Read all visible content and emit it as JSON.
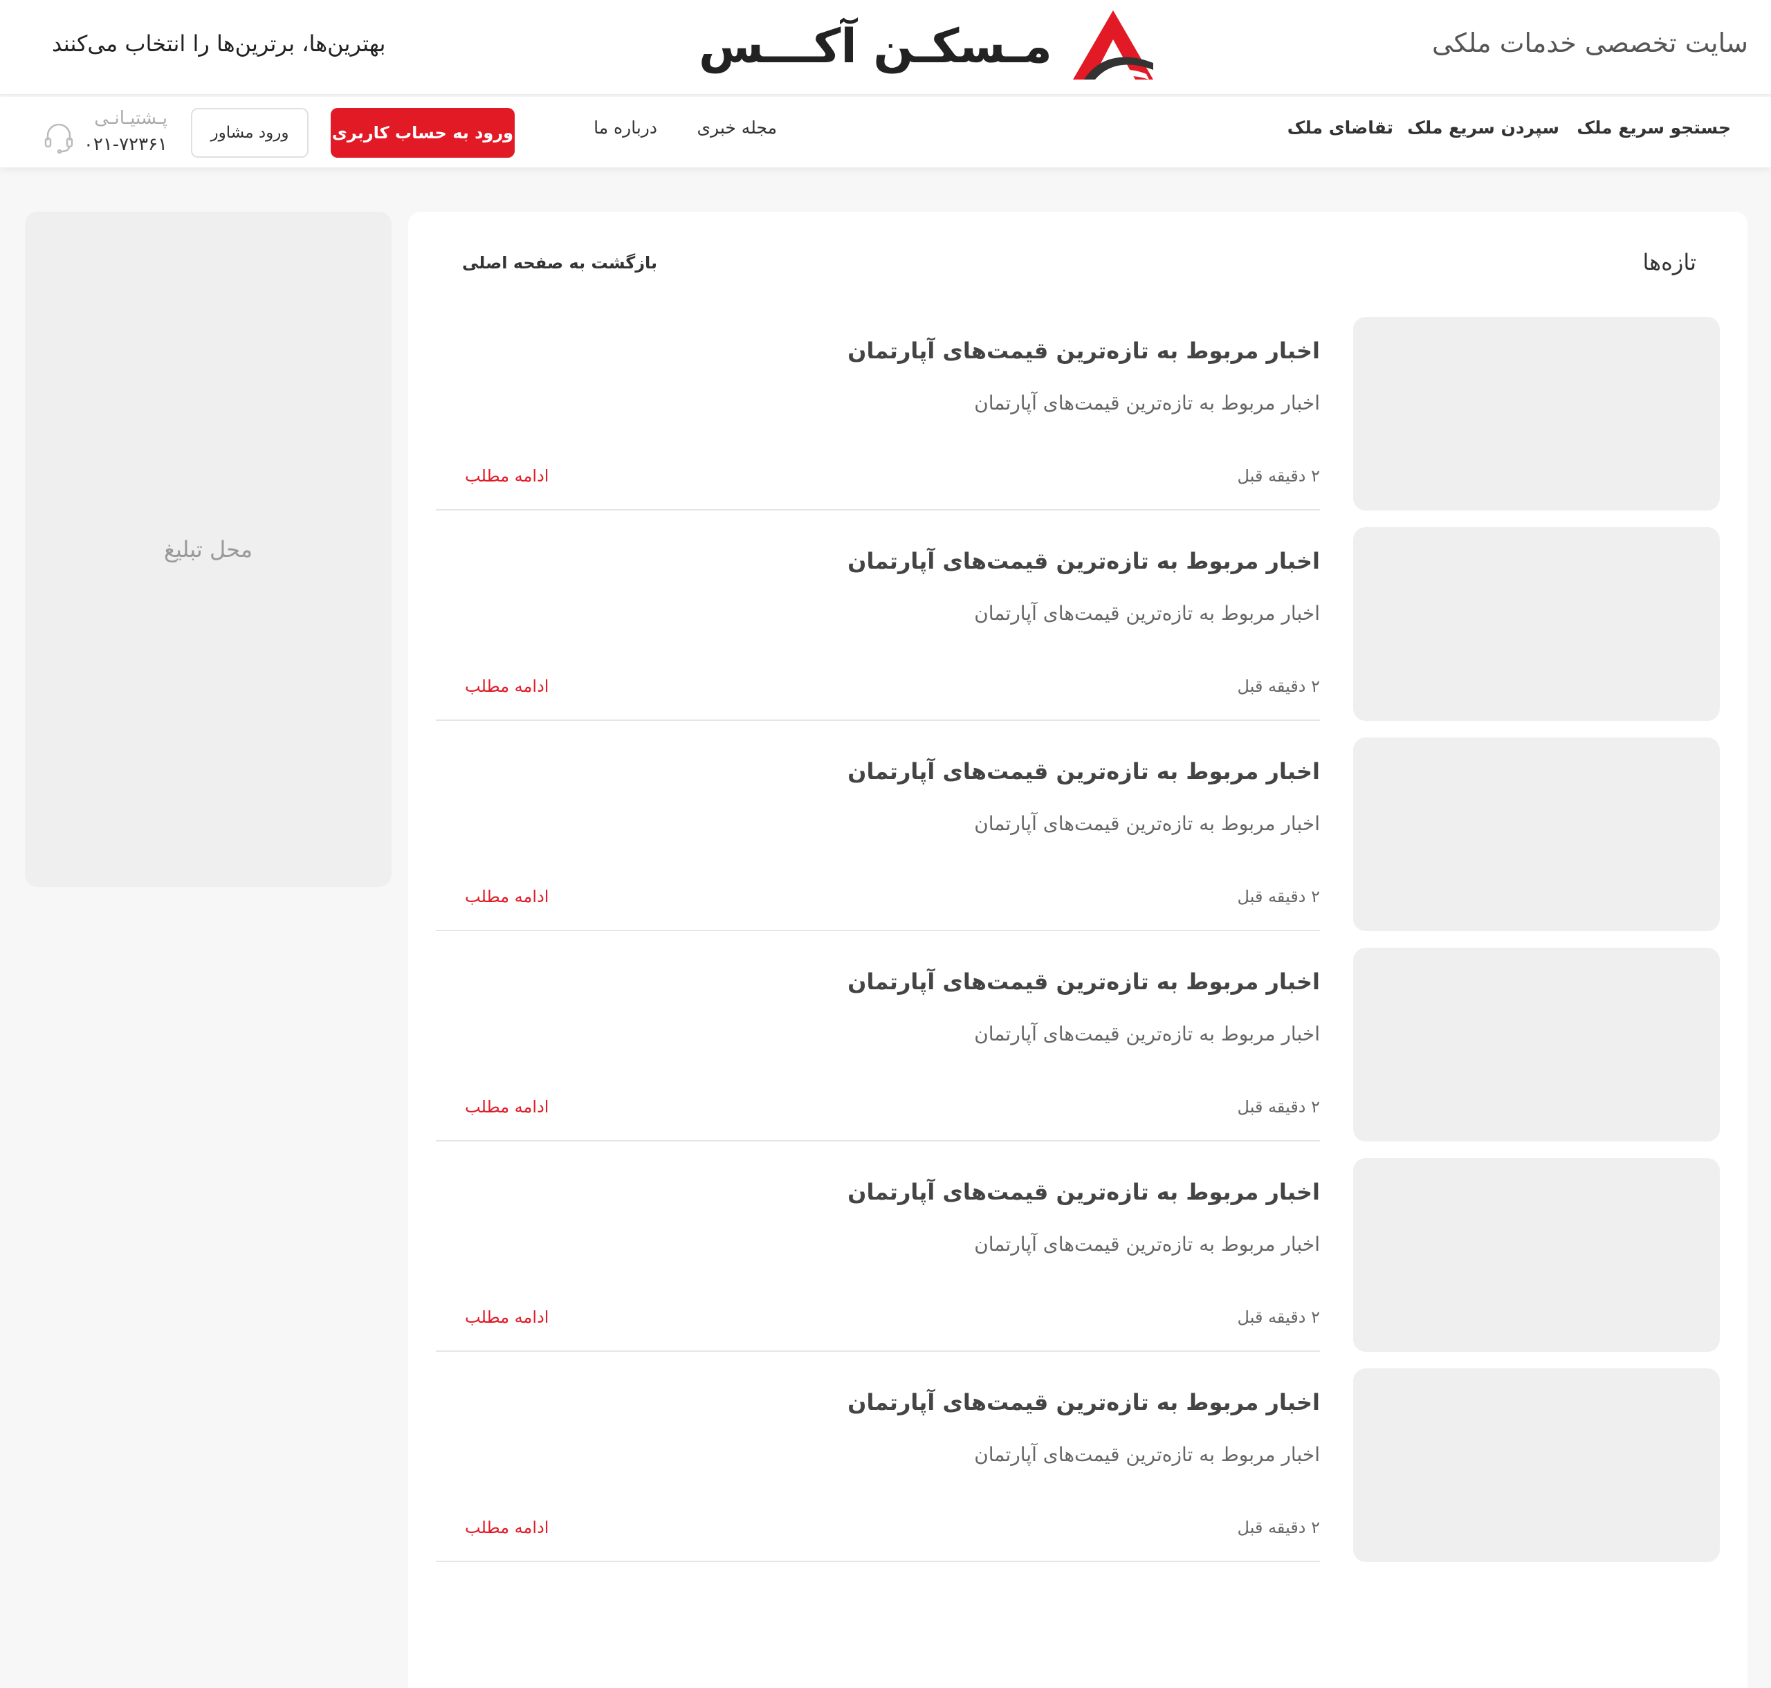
{
  "header": {
    "tagline_right": "سایت تخصصی خدمات ملکی",
    "brand_name": "مـسکـن آکـــس",
    "tagline_left": "بهترین‌ها، برترین‌ها را انتخاب می‌کنند",
    "brand_colors": {
      "accent": "#e11a26",
      "dark": "#333333"
    }
  },
  "nav": {
    "items": [
      "جستجو سریع ملک",
      "سپردن سریع ملک",
      "تقاضای ملک",
      "مجله خبری",
      "درباره ما"
    ],
    "login_button": "ورود به حساب کاربری",
    "advisor_button": "ورود مشاور",
    "support_label": "پـشتیـانـی",
    "support_phone": "۰۲۱-۷۲۳۶۱",
    "support_icon": "headset-icon"
  },
  "sidebar": {
    "ad_label": "محل تبلیغ"
  },
  "main": {
    "section_title": "تازه‌ها",
    "back_link": "بازگشت به صفحه اصلی",
    "articles": [
      {
        "title": "اخبار مربوط به تازه‌ترین قیمت‌های آپارتمان",
        "summary": "اخبار مربوط به تازه‌ترین قیمت‌های آپارتمان",
        "time": "۲ دقیقه قبل",
        "more": "ادامه مطلب"
      },
      {
        "title": "اخبار مربوط به تازه‌ترین قیمت‌های آپارتمان",
        "summary": "اخبار مربوط به تازه‌ترین قیمت‌های آپارتمان",
        "time": "۲ دقیقه قبل",
        "more": "ادامه مطلب"
      },
      {
        "title": "اخبار مربوط به تازه‌ترین قیمت‌های آپارتمان",
        "summary": "اخبار مربوط به تازه‌ترین قیمت‌های آپارتمان",
        "time": "۲ دقیقه قبل",
        "more": "ادامه مطلب"
      },
      {
        "title": "اخبار مربوط به تازه‌ترین قیمت‌های آپارتمان",
        "summary": "اخبار مربوط به تازه‌ترین قیمت‌های آپارتمان",
        "time": "۲ دقیقه قبل",
        "more": "ادامه مطلب"
      },
      {
        "title": "اخبار مربوط به تازه‌ترین قیمت‌های آپارتمان",
        "summary": "اخبار مربوط به تازه‌ترین قیمت‌های آپارتمان",
        "time": "۲ دقیقه قبل",
        "more": "ادامه مطلب"
      },
      {
        "title": "اخبار مربوط به تازه‌ترین قیمت‌های آپارتمان",
        "summary": "اخبار مربوط به تازه‌ترین قیمت‌های آپارتمان",
        "time": "۲ دقیقه قبل",
        "more": "ادامه مطلب"
      }
    ]
  }
}
